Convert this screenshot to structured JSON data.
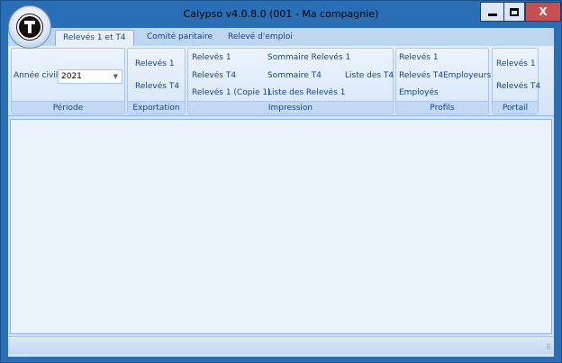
{
  "window": {
    "title": "Calypso v4.0.8.0  (001 - Ma compagnie)",
    "close_glyph": "X",
    "accent": "#2a6fb6",
    "close_color": "#c75050"
  },
  "tabs": [
    {
      "label": "Relevés 1 et T4",
      "active": true
    },
    {
      "label": "Comité paritaire",
      "active": false
    },
    {
      "label": "Relevé d'emploi",
      "active": false
    }
  ],
  "ribbon": {
    "periode": {
      "label": "Période",
      "year_label": "Année civile",
      "year_value": "2021"
    },
    "exportation": {
      "label": "Exportation",
      "items": [
        "Relevés 1",
        "Relevés T4"
      ]
    },
    "impression": {
      "label": "Impression",
      "col1": [
        "Relevés 1",
        "Relevés T4",
        "Relevés 1 (Copie 1)"
      ],
      "col2": [
        "Sommaire Relevés 1",
        "Sommaire T4",
        "Liste des Relevés 1"
      ],
      "col3": [
        "Liste des T4"
      ]
    },
    "profils": {
      "label": "Profils",
      "items": [
        "Relevés 1",
        "Relevés T4",
        "Employeurs",
        "Employés"
      ]
    },
    "portail": {
      "label": "Portail",
      "items": [
        "Relevés 1",
        "Relevés T4"
      ]
    }
  }
}
